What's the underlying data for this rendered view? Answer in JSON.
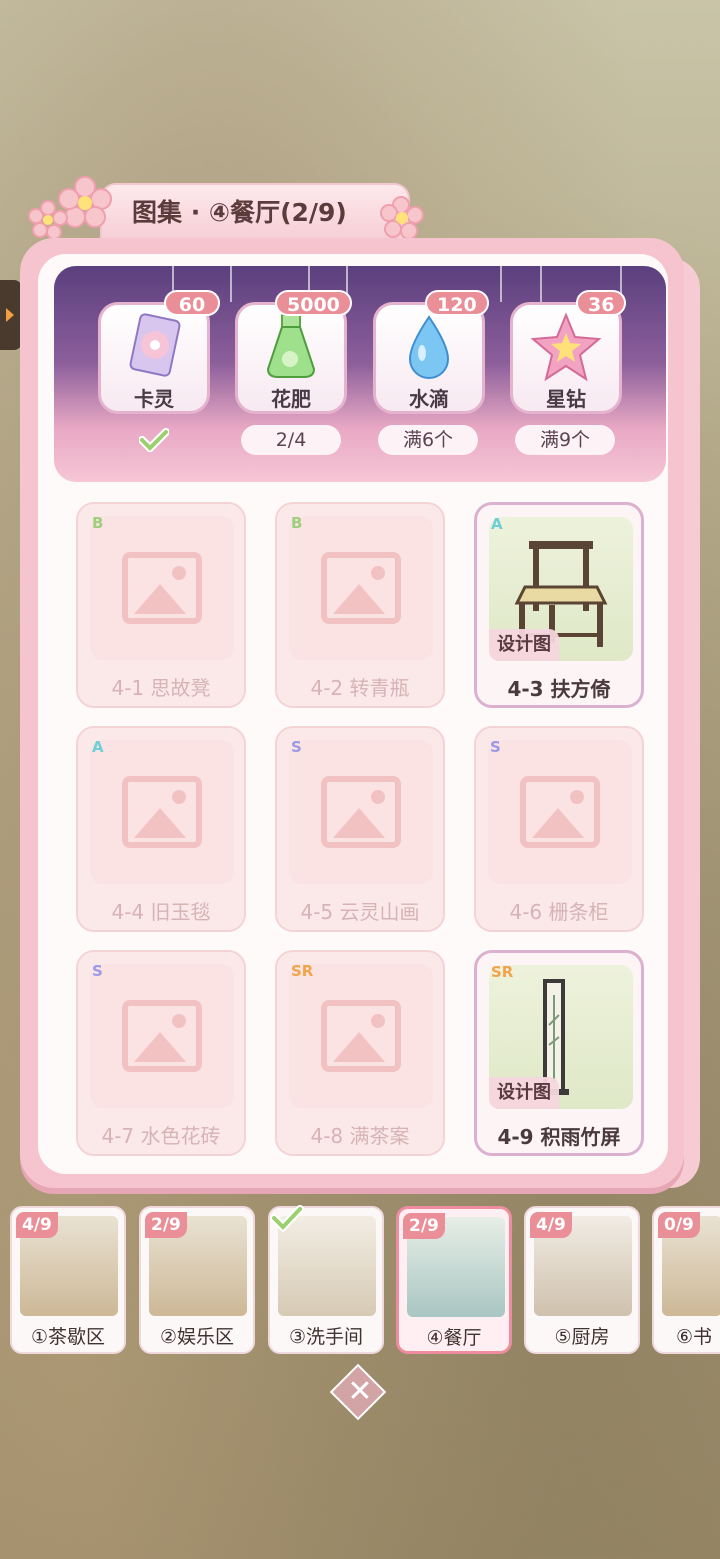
{
  "title": "图集 · ④餐厅(2/9)",
  "rewards": [
    {
      "name": "卡灵",
      "badge": "60",
      "condition": "",
      "icon": "card-icon",
      "claimed": true
    },
    {
      "name": "花肥",
      "badge": "5000",
      "condition": "2/4",
      "icon": "fertilizer-icon"
    },
    {
      "name": "水滴",
      "badge": "120",
      "condition": "满6个",
      "icon": "water-drop-icon"
    },
    {
      "name": "星钻",
      "badge": "36",
      "condition": "满9个",
      "icon": "star-diamond-icon"
    }
  ],
  "items": [
    {
      "label": "4-1 思故凳",
      "rarity": "B",
      "owned": false
    },
    {
      "label": "4-2 转青瓶",
      "rarity": "B",
      "owned": false
    },
    {
      "label": "4-3 扶方倚",
      "rarity": "A",
      "owned": true,
      "tag": "设计图"
    },
    {
      "label": "4-4 旧玉毯",
      "rarity": "A",
      "owned": false
    },
    {
      "label": "4-5 云灵山画",
      "rarity": "S",
      "owned": false
    },
    {
      "label": "4-6 栅条柜",
      "rarity": "S",
      "owned": false
    },
    {
      "label": "4-7 水色花砖",
      "rarity": "S",
      "owned": false
    },
    {
      "label": "4-8 满茶案",
      "rarity": "SR",
      "owned": false
    },
    {
      "label": "4-9 积雨竹屏",
      "rarity": "SR",
      "owned": true,
      "tag": "设计图"
    }
  ],
  "rooms": [
    {
      "name": "①茶歇区",
      "progress": "4/9"
    },
    {
      "name": "②娱乐区",
      "progress": "2/9"
    },
    {
      "name": "③洗手间",
      "progress": "",
      "complete": true
    },
    {
      "name": "④餐厅",
      "progress": "2/9",
      "active": true
    },
    {
      "name": "⑤厨房",
      "progress": "4/9"
    },
    {
      "name": "⑥书",
      "progress": "0/9"
    }
  ],
  "close_label": "✕",
  "colors": {
    "accent": "#ea8e98",
    "panel": "#f5c4cf",
    "rarity_B": "#9fcf7e",
    "rarity_A": "#6ccfd6",
    "rarity_S": "#9a9ae6",
    "rarity_SR": "#f0a54c"
  }
}
